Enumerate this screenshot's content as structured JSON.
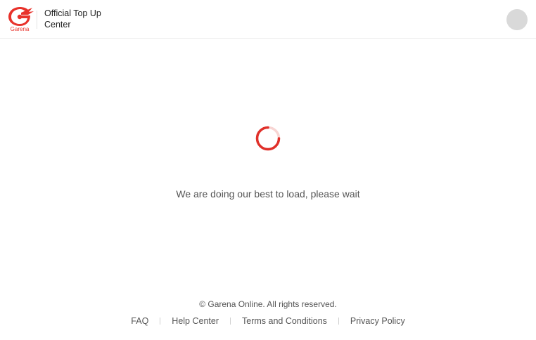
{
  "header": {
    "brand_name": "Garena",
    "title": "Official Top Up Center",
    "brand_color": "#e8322b",
    "avatar_icon": "user-avatar-placeholder"
  },
  "main": {
    "loading_icon": "spinner-icon",
    "loading_message": "We are doing our best to load, please wait"
  },
  "footer": {
    "copyright": "© Garena Online. All rights reserved.",
    "links": [
      {
        "label": "FAQ"
      },
      {
        "label": "Help Center"
      },
      {
        "label": "Terms and Conditions"
      },
      {
        "label": "Privacy Policy"
      }
    ]
  }
}
